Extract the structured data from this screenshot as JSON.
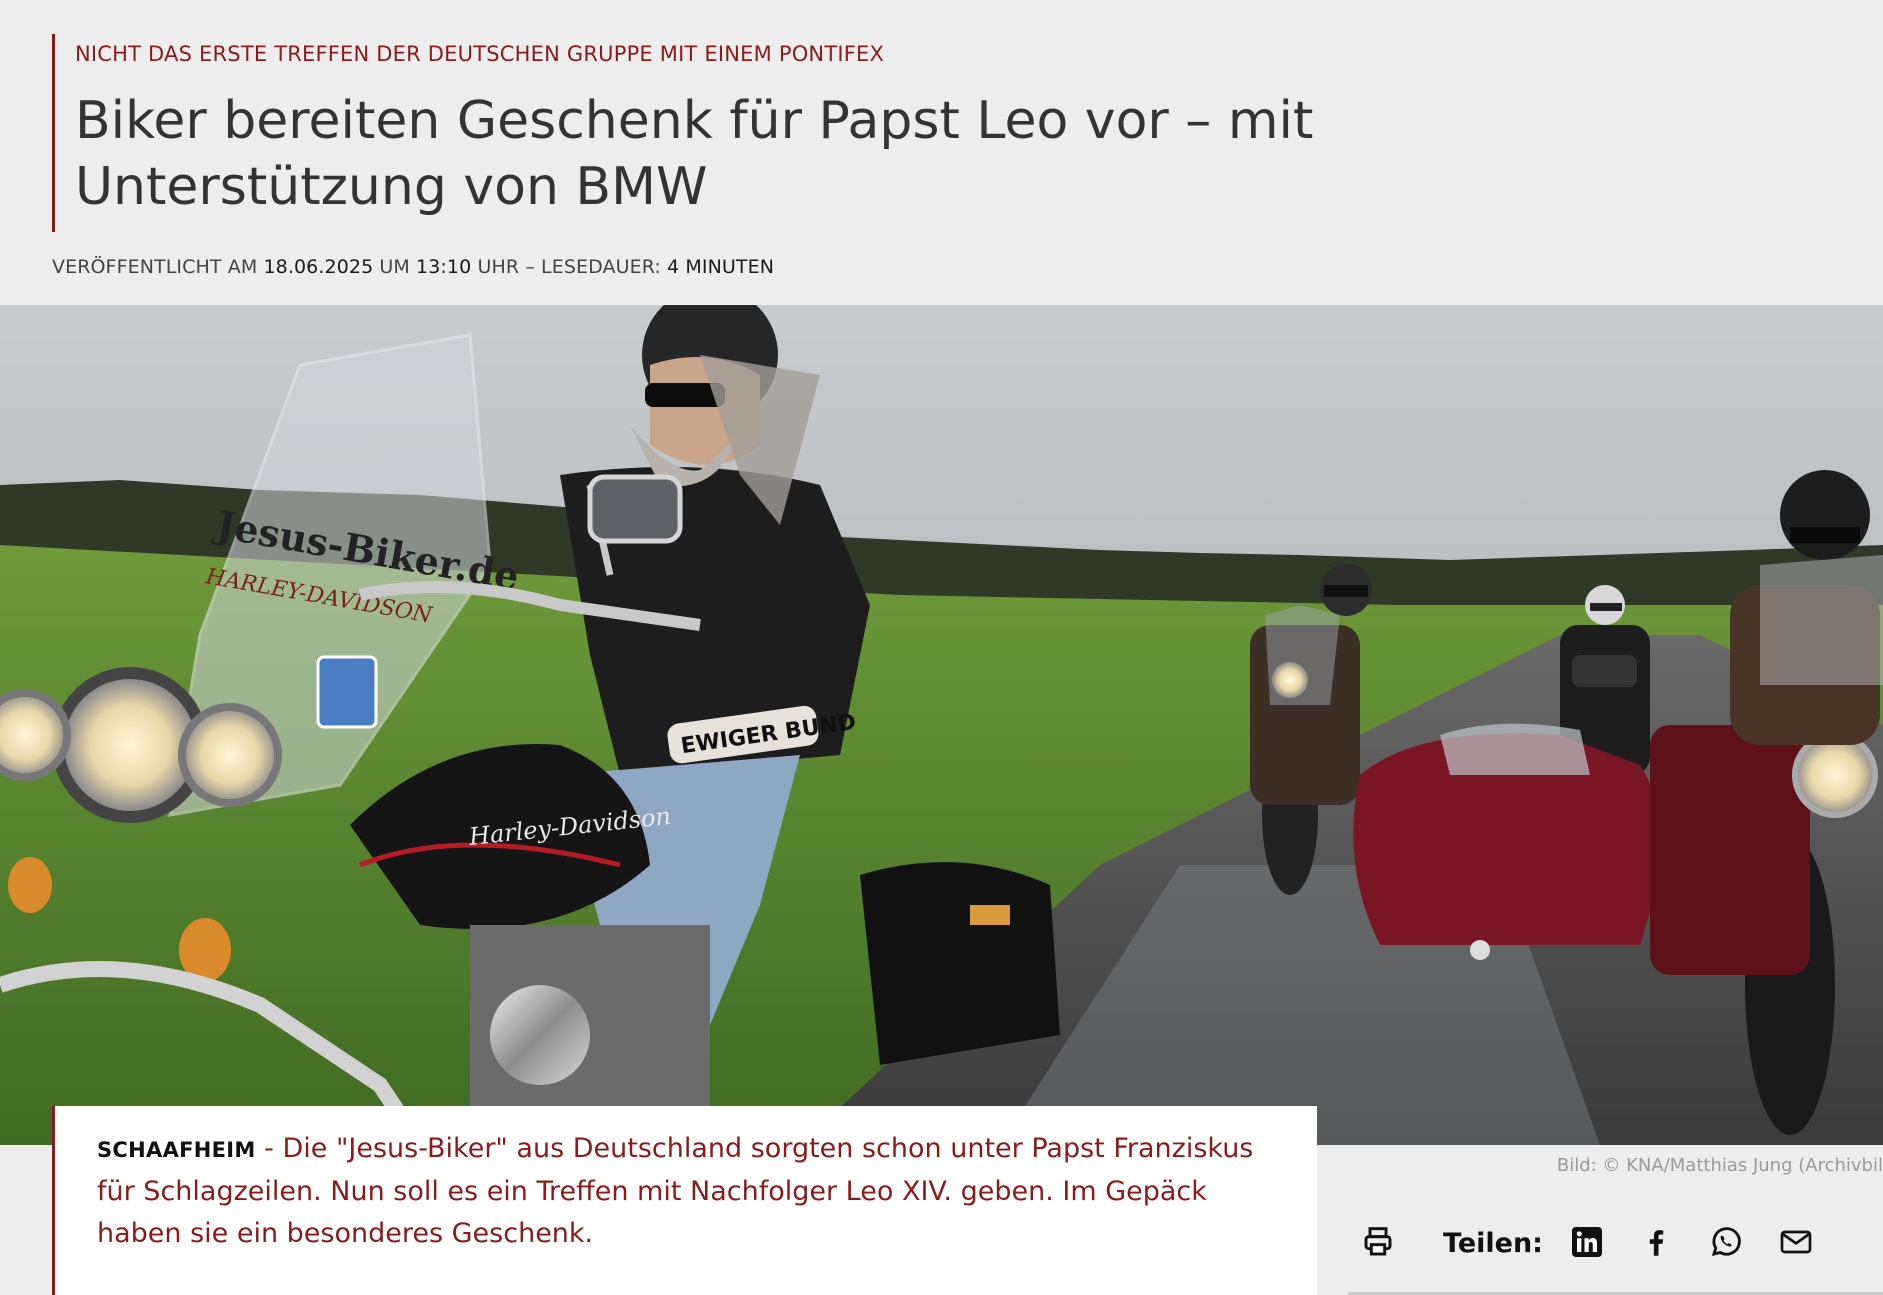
{
  "article": {
    "kicker": "NICHT DAS ERSTE TREFFEN DER DEUTSCHEN GRUPPE MIT EINEM PONTIFEX",
    "title_line1": "Biker bereiten Geschenk für Papst Leo vor – mit",
    "title_line2": "Unterstützung von BMW",
    "meta": {
      "published_prefix": "VERÖFFENTLICHT AM ",
      "date": "18.06.2025",
      "time_prefix": " UM ",
      "time": "13:10",
      "reading_prefix": " UHR – LESEDAUER: ",
      "reading_time": "4 MINUTEN"
    },
    "hero_image": {
      "windshield_text": "Jesus-Biker.de",
      "brand_text": "HARLEY-DAVIDSON",
      "tank_text": "Harley-Davidson",
      "patch_text": "EWIGER BUND",
      "credit": "Bild: © KNA/Matthias Jung  (Archivbil"
    },
    "lead": {
      "dateline": "SCHAAFHEIM",
      "separator": " - ",
      "text": "Die \"Jesus-Biker\" aus Deutschland sorgten schon unter Papst Franziskus für Schlagzeilen. Nun soll es ein Treffen mit Nachfolger Leo XIV. geben. Im Gepäck haben sie ein besonderes Geschenk."
    }
  },
  "share": {
    "label": "Teilen:",
    "icons": [
      "print-icon",
      "linkedin-icon",
      "facebook-icon",
      "whatsapp-icon",
      "mail-icon"
    ]
  },
  "colors": {
    "accent": "#8b1a1a",
    "background": "#ededed"
  }
}
